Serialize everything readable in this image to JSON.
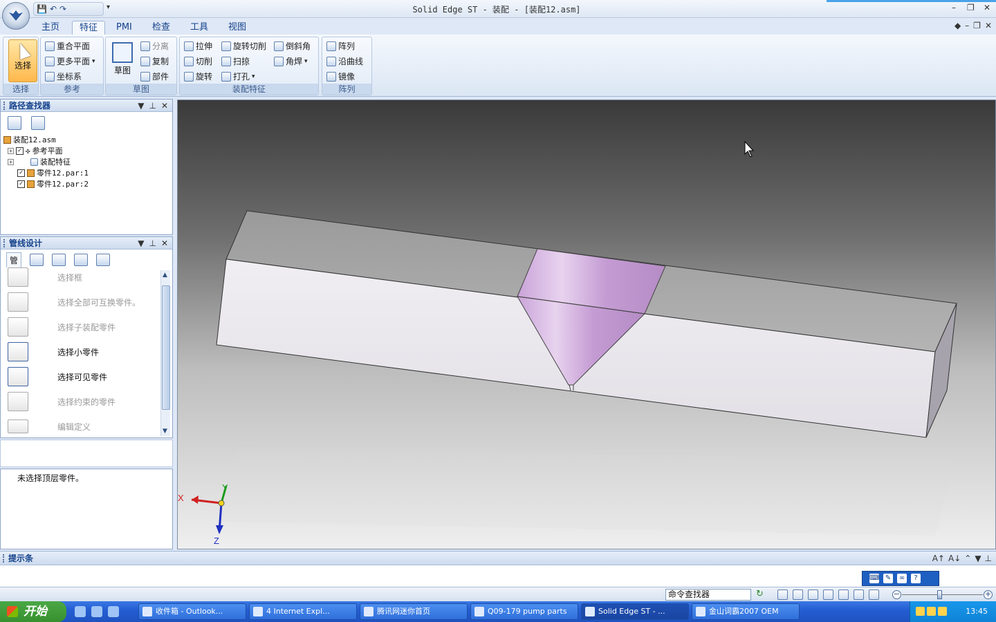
{
  "window": {
    "title": "Solid Edge ST - 装配 - [装配12.asm]",
    "minimize": "–",
    "restore": "❐",
    "close": "✕"
  },
  "ribbon": {
    "tabs": [
      {
        "label": "主页",
        "active": false
      },
      {
        "label": "特征",
        "active": true
      },
      {
        "label": "PMI",
        "active": false
      },
      {
        "label": "检查",
        "active": false
      },
      {
        "label": "工具",
        "active": false
      },
      {
        "label": "视图",
        "active": false
      }
    ],
    "groups": {
      "select": {
        "label": "选择",
        "button": "选择"
      },
      "reference": {
        "label": "参考",
        "items": [
          "重合平面",
          "更多平面",
          "坐标系"
        ]
      },
      "sketch": {
        "label": "草图",
        "button": "草图",
        "items": [
          "分离",
          "复制",
          "部件"
        ]
      },
      "assembly_features": {
        "label": "装配特征",
        "items": [
          "拉伸",
          "旋转切削",
          "倒斜角",
          "切削",
          "扫掠",
          "角焊",
          "旋转",
          "打孔"
        ]
      },
      "pattern": {
        "label": "阵列",
        "items": [
          "阵列",
          "沿曲线",
          "镜像"
        ]
      }
    }
  },
  "path_finder": {
    "title": "路径查找器",
    "root": "装配12.asm",
    "items": [
      "参考平面",
      "装配特征",
      "零件12.par:1",
      "零件12.par:2"
    ]
  },
  "pipeline": {
    "title": "管线设计",
    "tab_label": "管",
    "options": [
      {
        "label": "选择框",
        "enabled": false
      },
      {
        "label": "选择全部可互换零件。",
        "enabled": false
      },
      {
        "label": "选择子装配零件",
        "enabled": false
      },
      {
        "label": "选择小零件",
        "enabled": true
      },
      {
        "label": "选择可见零件",
        "enabled": true
      },
      {
        "label": "选择约束的零件",
        "enabled": false
      },
      {
        "label": "编辑定义",
        "enabled": false
      }
    ]
  },
  "status_message": "未选择顶层零件。",
  "axes": {
    "x": "X",
    "y": "Y",
    "z": "Z"
  },
  "prompt_bar": {
    "title": "提示条"
  },
  "command_finder": {
    "value": "命令查找器"
  },
  "taskbar": {
    "start": "开始",
    "buttons": [
      "收件箱 - Outlook...",
      "4 Internet Expl...",
      "腾讯网迷你首页",
      "Q09-179 pump parts",
      "Solid Edge ST - ...",
      "金山词霸2007 OEM"
    ],
    "clock": "13:45"
  },
  "colors": {
    "accent": "#15428b",
    "active_button": "#ffb84c",
    "weld": "#d9b6e6"
  }
}
